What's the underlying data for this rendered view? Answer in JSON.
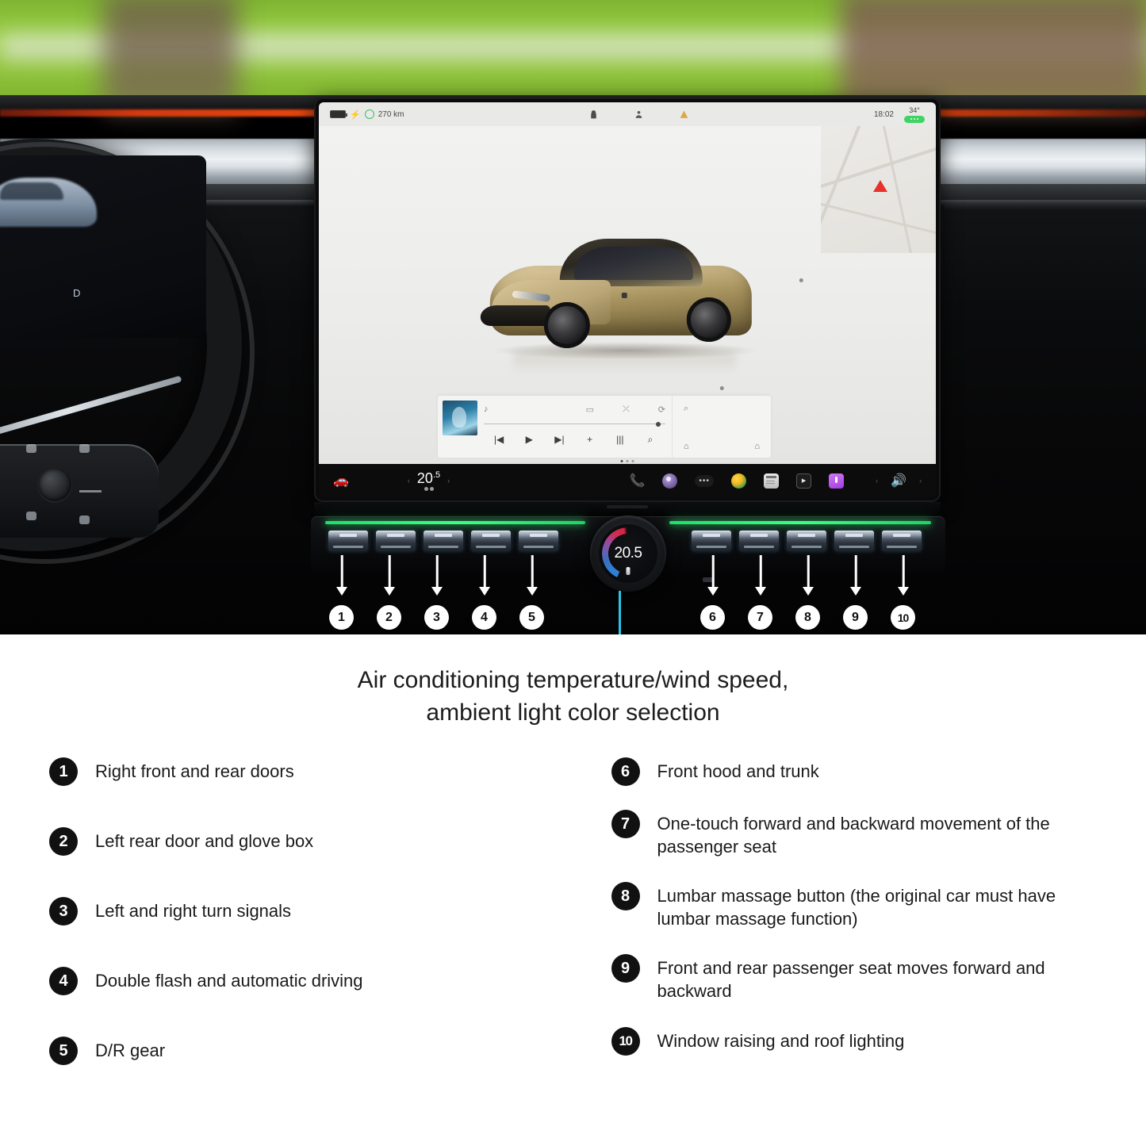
{
  "photo": {
    "screen": {
      "status_bar": {
        "range": "270 km",
        "time": "18:02",
        "temperature": "34°",
        "battery_icon": "battery-icon",
        "charge_icon": "charging-icon",
        "lock_icon": "lock-icon",
        "person_icon": "driver-profile-icon",
        "seat_indicator": "seat-heater-pill"
      },
      "media": {
        "note_icon": "music-note-icon",
        "cast_icon": "cast-icon",
        "shuffle_icon": "shuffle-icon",
        "repeat_icon": "repeat-icon",
        "prev_icon": "previous-track-icon",
        "play_icon": "play-icon",
        "next_icon": "next-track-icon",
        "add_icon": "add-icon",
        "equalizer_icon": "equalizer-icon",
        "search_icon": "search-icon",
        "panel_search_icon": "search-icon",
        "home_icon": "home-icon",
        "garage_icon": "garage-icon"
      },
      "toolbar": {
        "car_icon": "car-controls-icon",
        "temp_value": "20",
        "temp_decimal": ".5",
        "chev_left": "‹",
        "chev_right": "›",
        "phone_icon": "phone-icon",
        "media_icon": "media-player-icon",
        "more_icon": "more-apps-icon",
        "browser_icon": "browser-icon",
        "news_icon": "news-icon",
        "video_icon": "video-icon",
        "app_icon": "purple-app-icon",
        "volume_icon": "volume-icon"
      }
    },
    "cluster": {
      "gear": "D"
    },
    "dial": {
      "value": "20.5"
    },
    "callout_numbers": [
      "1",
      "2",
      "3",
      "4",
      "5",
      "6",
      "7",
      "8",
      "9",
      "10"
    ]
  },
  "caption": {
    "line1": "Air conditioning temperature/wind speed,",
    "line2": "ambient light color selection"
  },
  "legend": {
    "left": [
      {
        "num": "1",
        "text": "Right front and rear doors"
      },
      {
        "num": "2",
        "text": "Left rear door and glove box"
      },
      {
        "num": "3",
        "text": "Left and right turn signals"
      },
      {
        "num": "4",
        "text": "Double flash and automatic driving"
      },
      {
        "num": "5",
        "text": "D/R gear"
      }
    ],
    "right": [
      {
        "num": "6",
        "text": "Front hood and trunk"
      },
      {
        "num": "7",
        "text": "One-touch forward and backward movement of the passenger seat"
      },
      {
        "num": "8",
        "text": "Lumbar massage button (the original car must have lumbar massage function)"
      },
      {
        "num": "9",
        "text": "Front and rear passenger seat moves forward and backward"
      },
      {
        "num": "10",
        "text": "Window raising and roof lighting"
      }
    ]
  },
  "colors": {
    "ambient_green": "#2de66e",
    "ambient_red": "#e8490f",
    "callout_cyan": "#29c4e8",
    "accent_white": "#ffffff"
  }
}
